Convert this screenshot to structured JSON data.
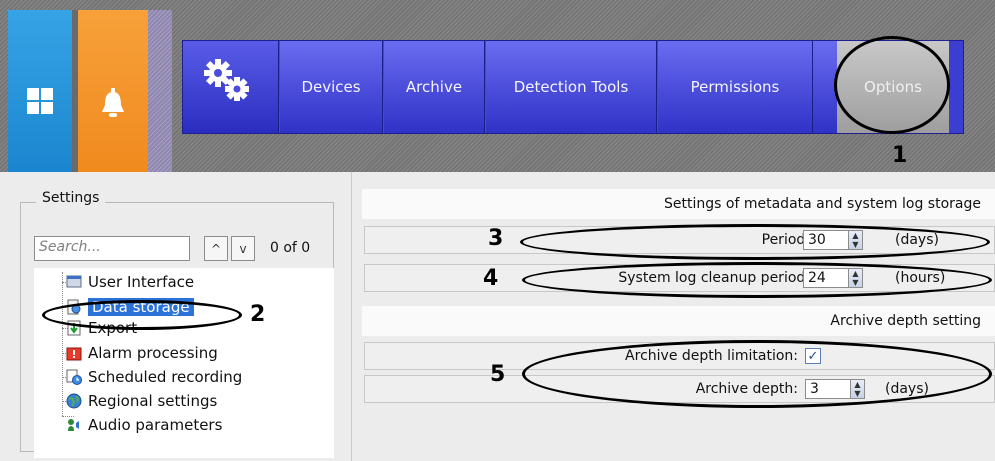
{
  "nav": {
    "items": [
      {
        "label": "Devices"
      },
      {
        "label": "Archive"
      },
      {
        "label": "Detection Tools"
      },
      {
        "label": "Permissions"
      },
      {
        "label": "Options"
      }
    ]
  },
  "settings": {
    "group_title": "Settings",
    "search_placeholder": "Search...",
    "up_symbol": "^",
    "down_symbol": "v",
    "counter": "0 of 0",
    "tree": [
      {
        "label": "User Interface",
        "icon": "user-interface-icon"
      },
      {
        "label": "Data storage",
        "icon": "data-storage-icon",
        "selected": true
      },
      {
        "label": "Export",
        "icon": "export-icon"
      },
      {
        "label": "Alarm processing",
        "icon": "alarm-processing-icon"
      },
      {
        "label": "Scheduled recording",
        "icon": "scheduled-recording-icon"
      },
      {
        "label": "Regional settings",
        "icon": "regional-settings-icon"
      },
      {
        "label": "Audio parameters",
        "icon": "audio-parameters-icon"
      }
    ]
  },
  "metadata_section": {
    "title": "Settings of metadata and system log storage",
    "period": {
      "label": "Period:",
      "value": "30",
      "unit": "(days)"
    },
    "cleanup": {
      "label": "System log cleanup period:",
      "value": "24",
      "unit": "(hours)"
    }
  },
  "archive_section": {
    "title": "Archive depth setting",
    "limitation": {
      "label": "Archive depth limitation:",
      "checked": true,
      "check_symbol": "✓"
    },
    "depth": {
      "label": "Archive depth:",
      "value": "3",
      "unit": "(days)"
    }
  },
  "spin_symbols": {
    "up": "▲",
    "down": "▼"
  },
  "annotations": {
    "n1": "1",
    "n2": "2",
    "n3": "3",
    "n4": "4",
    "n5": "5"
  },
  "colors": {
    "nav_blue": "#3b3ed0",
    "home_tile": "#1b86cf",
    "bell_tile": "#f08a1e",
    "selection": "#2b72d9"
  }
}
